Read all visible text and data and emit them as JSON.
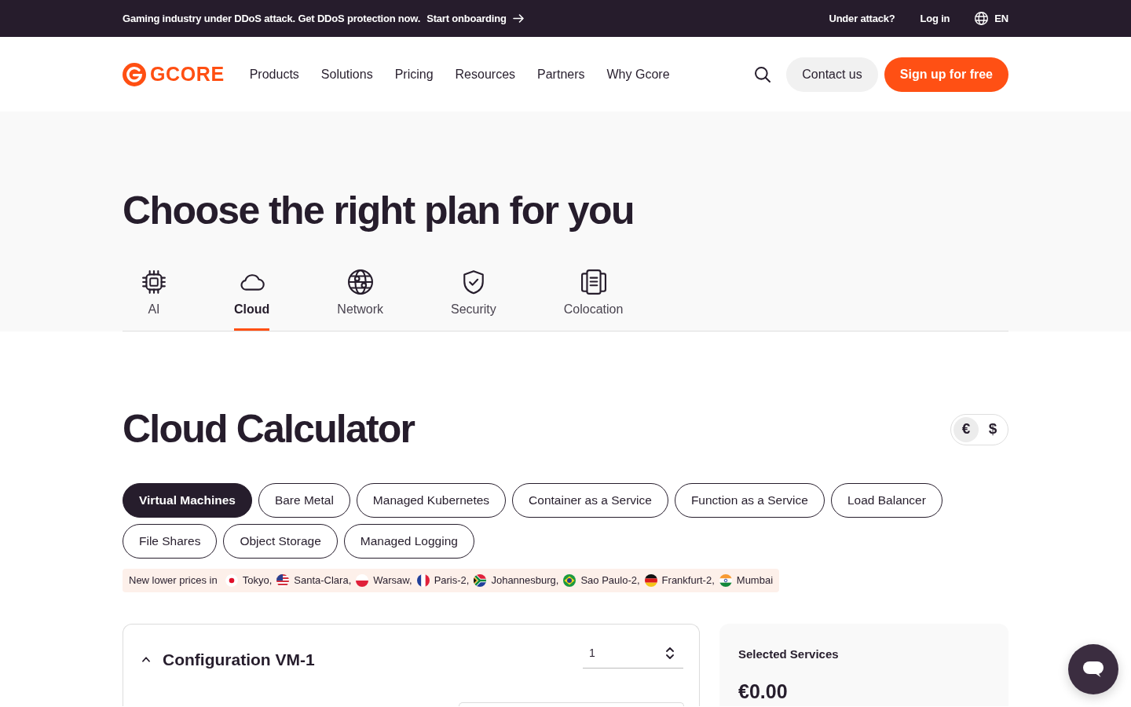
{
  "announcement": {
    "text": "Gaming industry under DDoS attack. Get DDoS protection now.",
    "link": "Start onboarding"
  },
  "top_links": [
    "Under attack?",
    "Log in"
  ],
  "language": "EN",
  "nav": {
    "logo": "GCORE",
    "items": [
      "Products",
      "Solutions",
      "Pricing",
      "Resources",
      "Partners",
      "Why Gcore"
    ],
    "buttons": [
      {
        "label": "Contact us",
        "kind": "secondary"
      },
      {
        "label": "Sign up for free",
        "kind": "primary"
      }
    ]
  },
  "hero": {
    "title": "Choose the right plan for you",
    "tabs": [
      {
        "label": "AI",
        "selected": false
      },
      {
        "label": "Cloud",
        "selected": true
      },
      {
        "label": "Network",
        "selected": false
      },
      {
        "label": "Security",
        "selected": false
      },
      {
        "label": "Colocation",
        "selected": false
      }
    ]
  },
  "calculator": {
    "title": "Cloud Calculator",
    "currencies": [
      {
        "symbol": "€",
        "selected": true
      },
      {
        "symbol": "$",
        "selected": false
      }
    ],
    "services": [
      {
        "label": "Virtual Machines",
        "selected": true
      },
      {
        "label": "Bare Metal",
        "selected": false
      },
      {
        "label": "Managed Kubernetes",
        "selected": false
      },
      {
        "label": "Container as a Service",
        "selected": false
      },
      {
        "label": "Function as a Service",
        "selected": false
      },
      {
        "label": "Load Balancer",
        "selected": false
      },
      {
        "label": "File Shares",
        "selected": false
      },
      {
        "label": "Object Storage",
        "selected": false
      },
      {
        "label": "Managed Logging",
        "selected": false
      }
    ],
    "notice": {
      "text": "New lower prices in",
      "locations": [
        "Tokyo,",
        "Santa-Clara,",
        "Warsaw,",
        "Paris-2,",
        "Johannesburg,",
        "Sao Paulo-2,",
        "Frankfurt-2,",
        "Mumbai"
      ]
    },
    "configuration": {
      "title": "Configuration VM-1",
      "expanded": true,
      "quantity": "1"
    },
    "summary": {
      "title": "Selected Services",
      "total": "€0.00"
    }
  }
}
